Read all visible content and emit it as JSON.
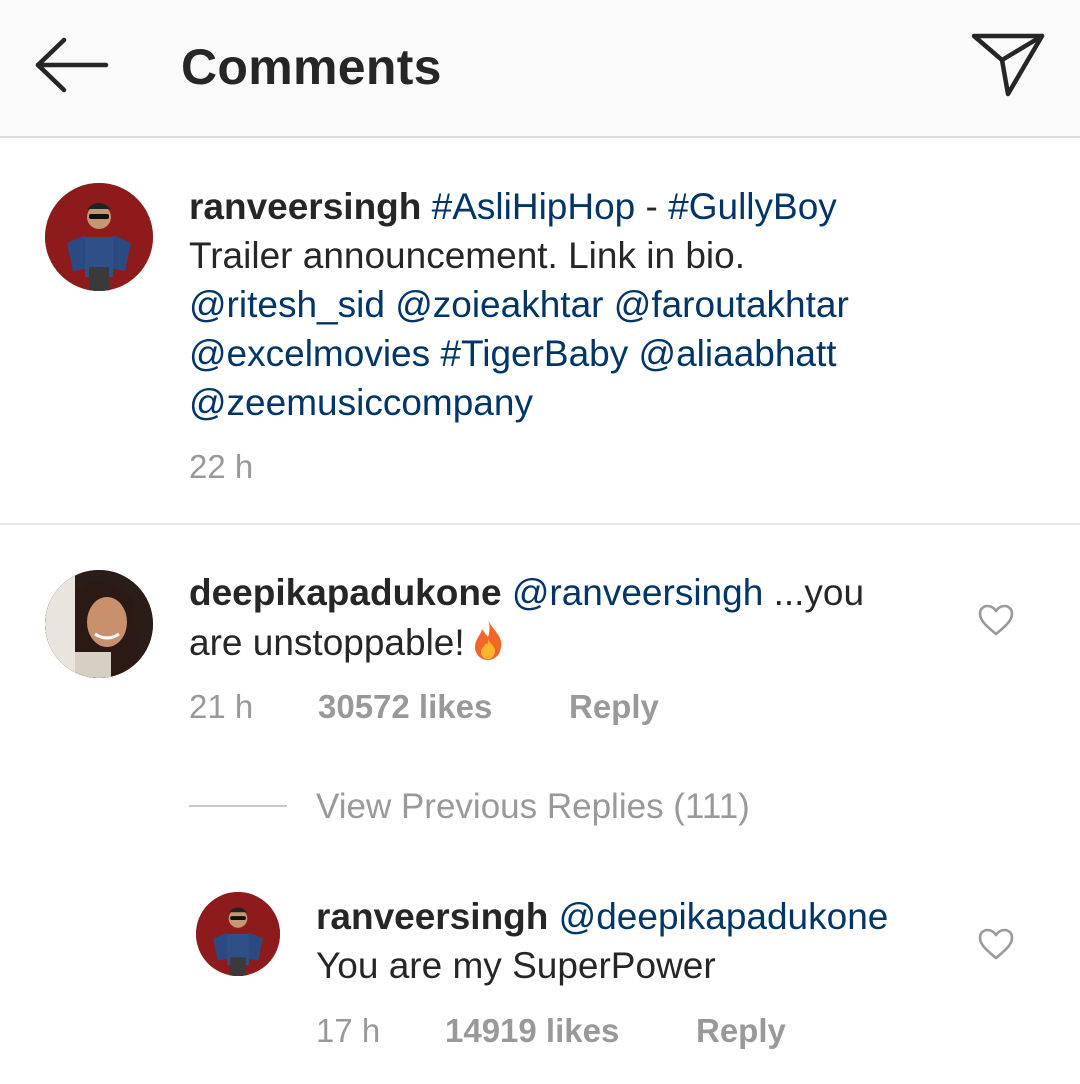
{
  "header": {
    "title": "Comments"
  },
  "caption": {
    "username": "ranveersingh",
    "hashtag_1": "#AsliHipHop",
    "sep": " - ",
    "hashtag_2": "#GullyBoy",
    "line2": "Trailer announcement. Link in bio.",
    "mention_1": "@ritesh_sid",
    "mention_2": "@zoieakhtar",
    "mention_3": "@faroutakhtar",
    "mention_4": "@excelmovies",
    "hashtag_3": "#TigerBaby",
    "mention_5": "@aliaabhatt",
    "mention_6": "@zeemusiccompany",
    "time": "22 h"
  },
  "comment": {
    "username": "deepikapadukone",
    "mention": "@ranveersingh",
    "text_1": "...you",
    "text_2": "are unstoppable!",
    "emoji": "fire-emoji",
    "time": "21 h",
    "likes": "30572 likes",
    "reply": "Reply"
  },
  "view_replies": "View Previous Replies (111)",
  "reply": {
    "username": "ranveersingh",
    "mention": "@deepikapadukone",
    "text": "You are my SuperPower",
    "time": "17 h",
    "likes": "14919 likes",
    "reply": "Reply"
  },
  "icons": {
    "back": "arrow-left-icon",
    "send": "paper-plane-icon",
    "like": "heart-outline-icon"
  },
  "colors": {
    "link": "#003569",
    "meta": "#999999",
    "text": "#262626",
    "header_bg": "#fafafa"
  }
}
